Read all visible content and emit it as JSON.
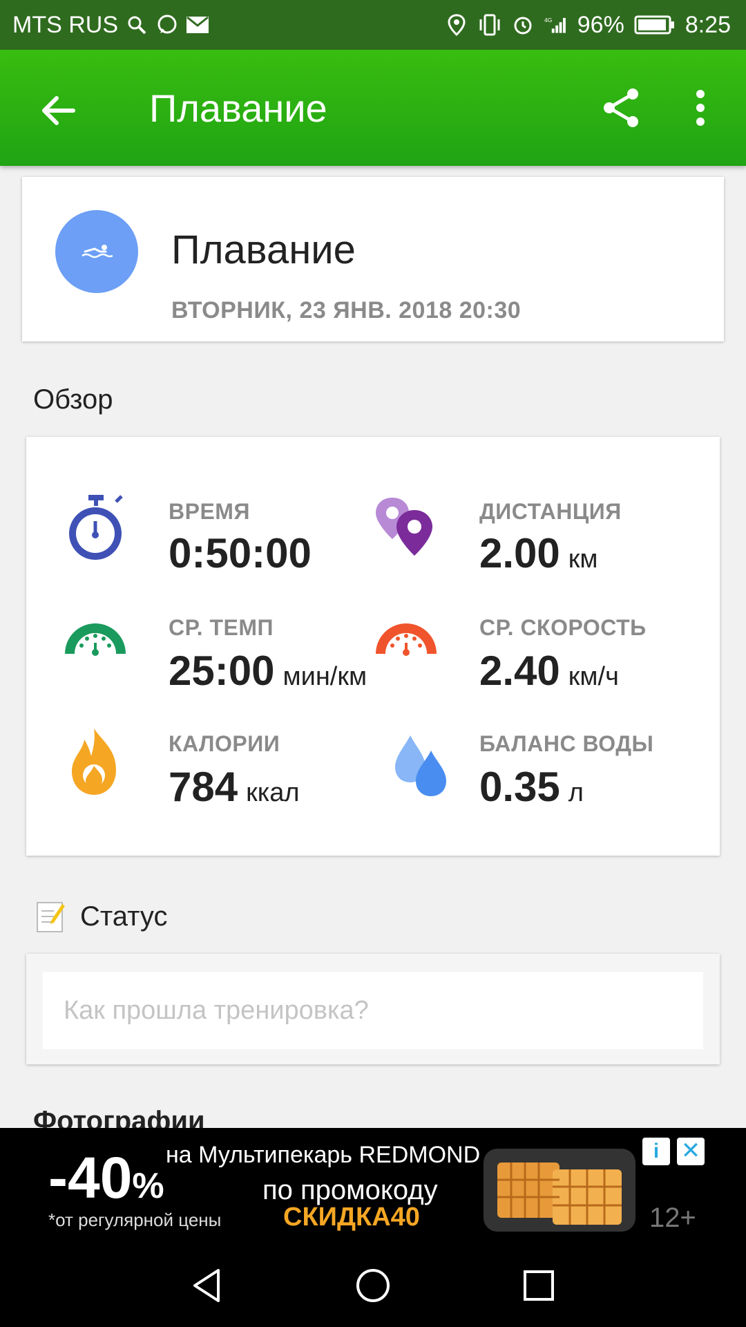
{
  "status_bar": {
    "carrier": "MTS RUS",
    "battery": "96%",
    "time": "8:25",
    "network": "4G"
  },
  "app_bar": {
    "title": "Плавание",
    "back_icon": "arrow-left-icon",
    "share_icon": "share-icon",
    "more_icon": "more-vert-icon"
  },
  "workout": {
    "title": "Плавание",
    "date": "ВТОРНИК, 23 ЯНВ. 2018 20:30",
    "avatar_color": "#6c9ff5",
    "icon": "swimming-icon"
  },
  "overview": {
    "label": "Обзор",
    "stats": [
      {
        "label": "ВРЕМЯ",
        "value": "0:50:00",
        "unit": "",
        "icon": "stopwatch-icon",
        "color": "#3f51b5"
      },
      {
        "label": "ДИСТАНЦИЯ",
        "value": "2.00",
        "unit": "км",
        "icon": "location-pins-icon",
        "color": "#8e44ad"
      },
      {
        "label": "СР. ТЕМП",
        "value": "25:00",
        "unit": "мин/км",
        "icon": "speedometer-icon",
        "color": "#1a9a5c"
      },
      {
        "label": "СР. СКОРОСТЬ",
        "value": "2.40",
        "unit": "км/ч",
        "icon": "speedometer-icon",
        "color": "#f0542c"
      },
      {
        "label": "КАЛОРИИ",
        "value": "784",
        "unit": "ккал",
        "icon": "flame-icon",
        "color": "#f5a623"
      },
      {
        "label": "БАЛАНС ВОДЫ",
        "value": "0.35",
        "unit": "л",
        "icon": "water-drops-icon",
        "color": "#4a8df0"
      }
    ]
  },
  "status": {
    "label": "Статус",
    "placeholder": "Как прошла тренировка?",
    "icon": "note-pencil-icon"
  },
  "photos": {
    "label": "Фотографии"
  },
  "ad": {
    "discount": "-40",
    "percent": "%",
    "note": "*от регулярной цены",
    "line1": "на Мультипекарь REDMOND",
    "line2": "по промокоду",
    "promo": "СКИДКА40",
    "age": "12+"
  },
  "colors": {
    "app_bar": "#2aae12",
    "status_bar": "#2f6b1f"
  }
}
